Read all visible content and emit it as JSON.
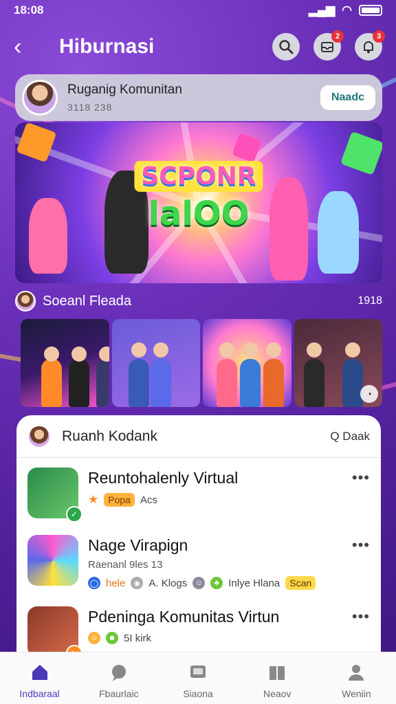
{
  "status_bar": {
    "time": "18:08"
  },
  "header": {
    "title": "Hiburnasi",
    "notif_badge_1": "2",
    "notif_badge_2": "3"
  },
  "community": {
    "name": "Ruganig Komunitan",
    "count": "3118 238",
    "join_label": "Naadc"
  },
  "hero": {
    "line1": "SCPONR",
    "line2": "lalOO"
  },
  "section": {
    "title": "Soeanl Fleada",
    "count": "1918"
  },
  "card": {
    "title": "Ruanh Kodank",
    "action": "Q Daak",
    "items": [
      {
        "title": "Reuntohalenly Virtual",
        "chip": "Popa",
        "sub": "Acs"
      },
      {
        "title": "Nage Virapign",
        "sub": "Raenanl 9les 13",
        "meta": [
          "hele",
          "A. Klogs",
          "Inlye Hlana"
        ],
        "chip": "Scan"
      },
      {
        "title": "Pdeninga Komunitas Virtun",
        "sub": "5I kirk"
      }
    ]
  },
  "nav": {
    "items": [
      "Indbaraal",
      "Fbaurlaic",
      "Siaona",
      "Neaov",
      "Weniin"
    ]
  },
  "colors": {
    "accent": "#4a3ab8",
    "brand_purple": "#6a2fb8",
    "join_text": "#1d7a7a",
    "badge_red": "#e8323a"
  }
}
